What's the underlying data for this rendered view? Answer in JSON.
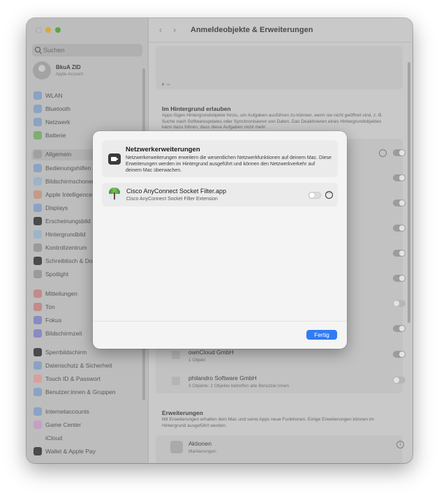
{
  "window": {
    "title": "Anmeldeobjekte & Erweiterungen",
    "nav_back": "‹",
    "nav_forward": "›"
  },
  "sidebar": {
    "search_placeholder": "Suchen",
    "account": {
      "name": "BkuA ZID",
      "subtitle": "Apple-Account"
    },
    "items": [
      {
        "label": "WLAN",
        "icon": "wifi-icon",
        "color": "#8aa3c4"
      },
      {
        "label": "Bluetooth",
        "icon": "bluetooth-icon",
        "color": "#8aa3c4"
      },
      {
        "label": "Netzwerk",
        "icon": "network-icon",
        "color": "#8aa3c4"
      },
      {
        "label": "Batterie",
        "icon": "battery-icon",
        "color": "#7fae72"
      },
      {
        "label": "Allgemein",
        "icon": "gear-icon",
        "color": "#a0a0a0",
        "active": true
      },
      {
        "label": "Bedienungshilfen",
        "icon": "accessibility-icon",
        "color": "#8aa3c4"
      },
      {
        "label": "Bildschirmschoner",
        "icon": "screensaver-icon",
        "color": "#9bb5c9"
      },
      {
        "label": "Apple Intelligence & Siri",
        "icon": "siri-icon",
        "color": "#c49a8a"
      },
      {
        "label": "Displays",
        "icon": "display-icon",
        "color": "#8aa3c4"
      },
      {
        "label": "Erscheinungsbild",
        "icon": "appearance-icon",
        "color": "#4a4a4a"
      },
      {
        "label": "Hintergrundbild",
        "icon": "wallpaper-icon",
        "color": "#9bb5c9"
      },
      {
        "label": "Kontrollzentrum",
        "icon": "control-center-icon",
        "color": "#9a9a9a"
      },
      {
        "label": "Schreibtisch & Dock",
        "icon": "dock-icon",
        "color": "#4a4a4a"
      },
      {
        "label": "Spotlight",
        "icon": "spotlight-icon",
        "color": "#9a9a9a"
      },
      {
        "label": "Mitteilungen",
        "icon": "notifications-icon",
        "color": "#c48a8a"
      },
      {
        "label": "Ton",
        "icon": "sound-icon",
        "color": "#c48a8a"
      },
      {
        "label": "Fokus",
        "icon": "focus-icon",
        "color": "#8a8ac4"
      },
      {
        "label": "Bildschirmzeit",
        "icon": "screen-time-icon",
        "color": "#8a8ac4"
      },
      {
        "label": "Sperrbildschirm",
        "icon": "lock-screen-icon",
        "color": "#4a4a4a"
      },
      {
        "label": "Datenschutz & Sicherheit",
        "icon": "privacy-icon",
        "color": "#8aa3c4"
      },
      {
        "label": "Touch ID & Passwort",
        "icon": "fingerprint-icon",
        "color": "#d6a0a0"
      },
      {
        "label": "Benutzer:innen & Gruppen",
        "icon": "users-icon",
        "color": "#8aa3c4"
      },
      {
        "label": "Internetaccounts",
        "icon": "internet-accounts-icon",
        "color": "#8aa3c4"
      },
      {
        "label": "Game Center",
        "icon": "game-center-icon",
        "color": "#c4a0c4"
      },
      {
        "label": "iCloud",
        "icon": "icloud-icon",
        "color": "#bcbcbc"
      },
      {
        "label": "Wallet & Apple Pay",
        "icon": "wallet-icon",
        "color": "#4a4a4a"
      }
    ]
  },
  "main": {
    "add_remove": "+  −",
    "background": {
      "title": "Im Hintergrund erlauben",
      "text": "Apps fügen Hintergrundobjekte hinzu, um Aufgaben ausführen zu können, wenn sie nicht geöffnet sind, z. B. Suche nach Softwareupdates oder Synchronisieren von Daten. Das Deaktivieren eines Hintergrundobjektes kann dazu führen, dass diese Aufgaben nicht mehr"
    },
    "items": [
      {
        "name": "ownCloud GmbH",
        "sub": "1 Objekt",
        "on": true
      },
      {
        "name": "philandro Software GmbH",
        "sub": "3 Objekte: 2 Objekte betreffen alle Benutzer:innen",
        "on": false
      }
    ],
    "extensions": {
      "title": "Erweiterungen",
      "text": "Mit Erweiterungen erhalten dein Mac und seine Apps neue Funktionen. Einige Erweiterungen können im Hintergrund ausgeführt werden.",
      "first": {
        "name": "Aktionen",
        "sub": "Markierungen"
      }
    }
  },
  "modal": {
    "title": "Netzwerkerweiterungen",
    "description": "Netzwerkerweiterungen erweitern die wesentlichen Netzwerkfunktionen auf deinem Mac. Diese Erweiterungen werden im Hintergrund ausgeführt und können den Netzwerkverkehr auf deinem Mac überwachen.",
    "extension": {
      "name": "Cisco AnyConnect Socket Filter.app",
      "sub": "Cisco AnyConnect Socket Filter Extension",
      "enabled": false,
      "more": "⋯"
    },
    "done_label": "Fertig"
  }
}
